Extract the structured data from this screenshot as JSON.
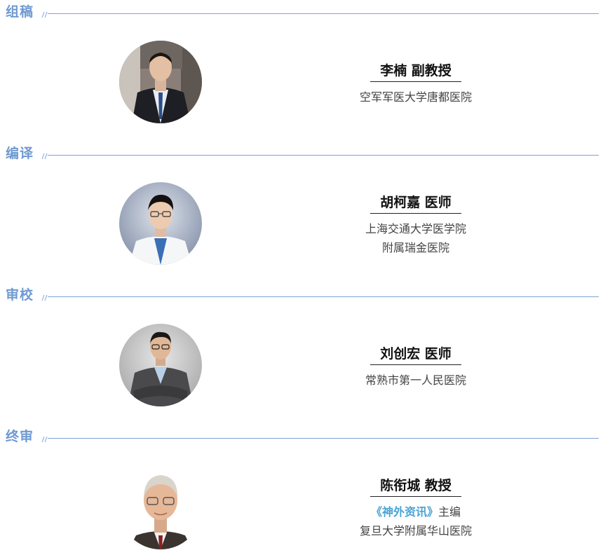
{
  "sections": [
    {
      "title": "组稿",
      "name": "李楠  副教授",
      "lines": [
        "空军军医大学唐都医院"
      ]
    },
    {
      "title": "编译",
      "name": "胡柯嘉  医师",
      "lines": [
        "上海交通大学医学院",
        "附属瑞金医院"
      ]
    },
    {
      "title": "审校",
      "name": "刘创宏  医师",
      "lines": [
        "常熟市第一人民医院"
      ]
    },
    {
      "title": "终审",
      "name": "陈衔城  教授",
      "journal": "《神外资讯》",
      "journal_suffix": "主编",
      "lines": [
        "复旦大学附属华山医院"
      ]
    }
  ],
  "colors": {
    "section_title": "#6f9ad2",
    "rule": "#7ea2d6",
    "journal_highlight": "#4aa3d5"
  },
  "icons": [
    "portrait-photo",
    "double-slash-divider"
  ]
}
